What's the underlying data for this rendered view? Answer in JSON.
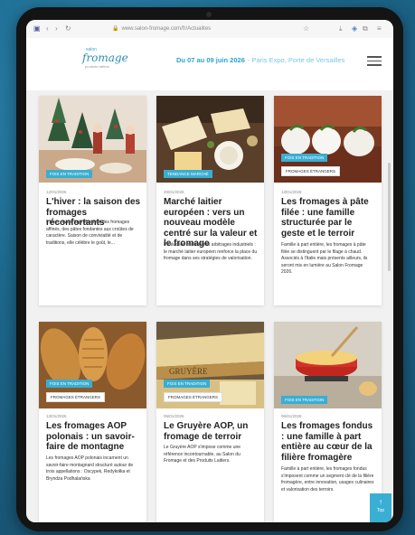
{
  "browser": {
    "url": "www.salon-fromage.com/fr/Actualites",
    "icons": [
      "sidebar-icon",
      "back-icon",
      "forward-icon",
      "reload-icon",
      "star-icon",
      "download-icon",
      "shield-icon",
      "extensions-icon",
      "menu-icon"
    ]
  },
  "header": {
    "logo_top": "salon",
    "logo_main": "fromage",
    "logo_sub": "produits laitiers",
    "event_dates": "Du 07 au 09 juin 2026",
    "event_venue": "- Paris Expo, Porte de Versailles"
  },
  "cards": [
    {
      "tags": [
        "Fois en Tradition"
      ],
      "date": "12/01/2026",
      "title": "L'hiver : la saison des fromages réconfortants",
      "text": "L'hiver révèle la profondeur des fromages affinés, des pâtes fondantes aux croûtes de caractère. Saison de convivialité et de traditions, elle célèbre le goût, le..."
    },
    {
      "tags": [
        "Tendance Marché"
      ],
      "date": "20/01/2026",
      "title": "Marché laitier européen : vers un nouveau modèle centré sur la valeur et le fromage",
      "text": "Production maîtrisée et arbitrages industriels : le marché laitier européen renforce la place du fromage dans ses stratégies de valorisation."
    },
    {
      "tags": [
        "Fois en Tradition",
        "Fromages étrangers"
      ],
      "date": "13/01/2026",
      "title": "Les fromages à pâte filée : une famille structurée par le geste et le terroir",
      "text": "Famille à part entière, les fromages à pâte filée se distinguent par le filage à chaud. Associés à l'Italie mais présents ailleurs, ils seront mis en lumière au Salon Fromage 2026."
    },
    {
      "tags": [
        "Fois en Tradition",
        "Fromages étrangers"
      ],
      "date": "13/01/2026",
      "title": "Les fromages AOP polonais : un savoir-faire de montagne",
      "text": "Les fromages AOP polonais incarnent un savoir-faire montagnard structuré autour de trois appellations : Oscypek, Redykołka et Bryndza Podhalańska"
    },
    {
      "tags": [
        "Fois en Tradition",
        "Fromages étrangers"
      ],
      "date": "06/01/2026",
      "title": "Le Gruyère AOP, un fromage de terroir",
      "text": "Le Gruyère AOP s'impose comme une référence incontournable, au Salon du Fromage et des Produits Laitiers."
    },
    {
      "tags": [
        "Fois en Tradition"
      ],
      "date": "06/01/2026",
      "title": "Les fromages fondus : une famille à part entière au cœur de la filière fromagère",
      "text": "Famille à part entière, les fromages fondus s'imposent comme un segment clé de la filière fromagère, entre innovation, usages culinaires et valorisation des terroirs."
    }
  ],
  "top_button": {
    "arrow": "↑",
    "label": "Top"
  },
  "colors": {
    "accent": "#39aed3",
    "background": "#1f6f95"
  }
}
